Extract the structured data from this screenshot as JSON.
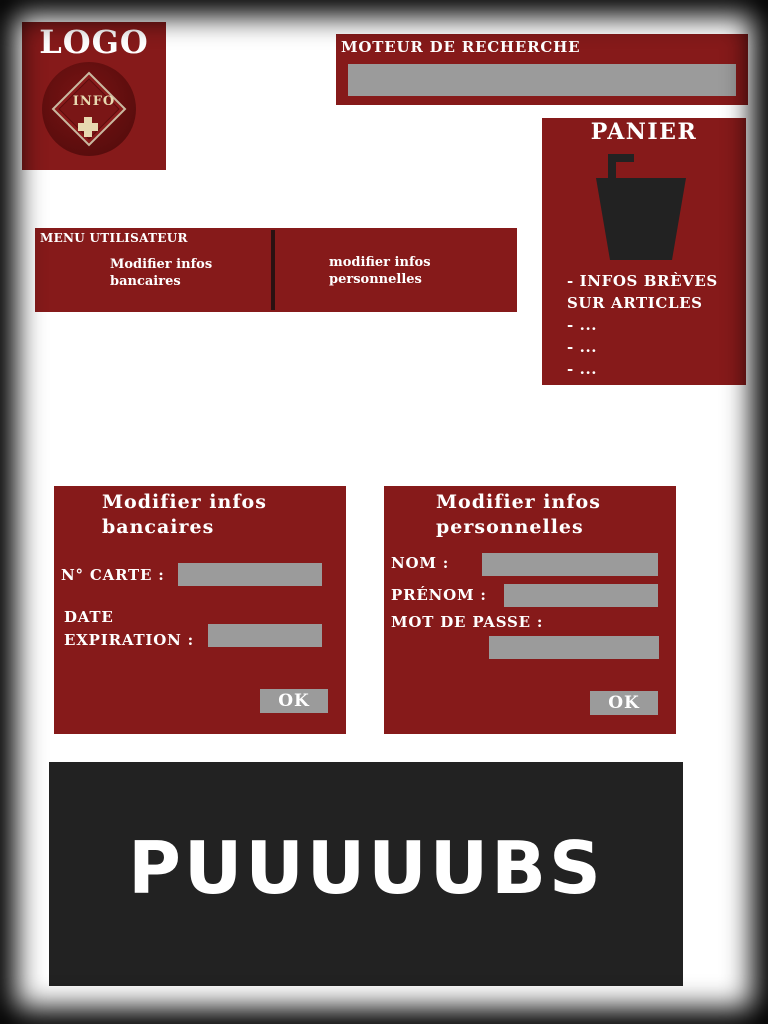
{
  "logo": {
    "title": "LOGO",
    "badge_text": "INFO"
  },
  "search": {
    "label": "MOTEUR DE RECHERCHE",
    "value": ""
  },
  "panier": {
    "title": "PANIER",
    "lines": [
      "- INFOS BRÈVES",
      "SUR ARTICLES",
      "- ...",
      "- ...",
      "- ..."
    ]
  },
  "user_menu": {
    "title": "MENU UTILISATEUR",
    "link_bank_line1": "Modifier infos",
    "link_bank_line2": "bancaires",
    "link_perso_line1": "modifier infos",
    "link_perso_line2": "personnelles"
  },
  "bank_form": {
    "title_line1": "Modifier infos",
    "title_line2": "bancaires",
    "card_label": "N° CARTE :",
    "card_value": "",
    "expiry_label_line1": "DATE",
    "expiry_label_line2": "EXPIRATION :",
    "expiry_value": "",
    "ok": "OK"
  },
  "perso_form": {
    "title_line1": "Modifier infos",
    "title_line2": "personnelles",
    "nom_label": "NOM :",
    "prenom_label": "PRÉNOM :",
    "password_label": "MOT DE PASSE :",
    "nom_value": "",
    "prenom_value": "",
    "password_value": "",
    "ok": "OK"
  },
  "ad": {
    "text": "PUUUUUBS"
  },
  "colors": {
    "panel": "#861a1a",
    "field": "#9b9b9b",
    "ad_bg": "#222222",
    "text": "#ffffff"
  }
}
